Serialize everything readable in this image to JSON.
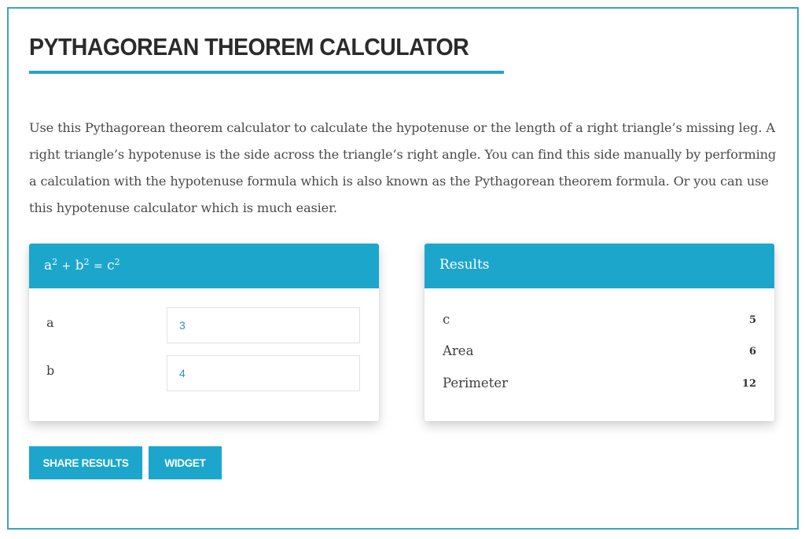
{
  "page": {
    "title": "PYTHAGOREAN THEOREM CALCULATOR",
    "intro": "Use this Pythagorean theorem calculator to calculate the hypotenuse or the length of a right triangle’s missing leg. A right triangle’s hypotenuse is the side across the triangle’s right angle. You can find this side manually by performing a calculation with the hypotenuse formula which is also known as the Pythagorean theorem formula. Or you can use this hypotenuse calculator which is much easier.",
    "accent_color": "#1ca6cb",
    "frame_color": "#3aa4c2"
  },
  "input_card": {
    "header": {
      "a": "a",
      "b": "b",
      "c": "c",
      "exp": "2",
      "plus": "+",
      "equals": "="
    },
    "fields": [
      {
        "label": "a",
        "value": "3"
      },
      {
        "label": "b",
        "value": "4"
      }
    ]
  },
  "results_card": {
    "header": "Results",
    "rows": [
      {
        "label": "c",
        "value": "5"
      },
      {
        "label": "Area",
        "value": "6"
      },
      {
        "label": "Perimeter",
        "value": "12"
      }
    ]
  },
  "actions": {
    "share_label": "SHARE RESULTS",
    "widget_label": "WIDGET"
  }
}
